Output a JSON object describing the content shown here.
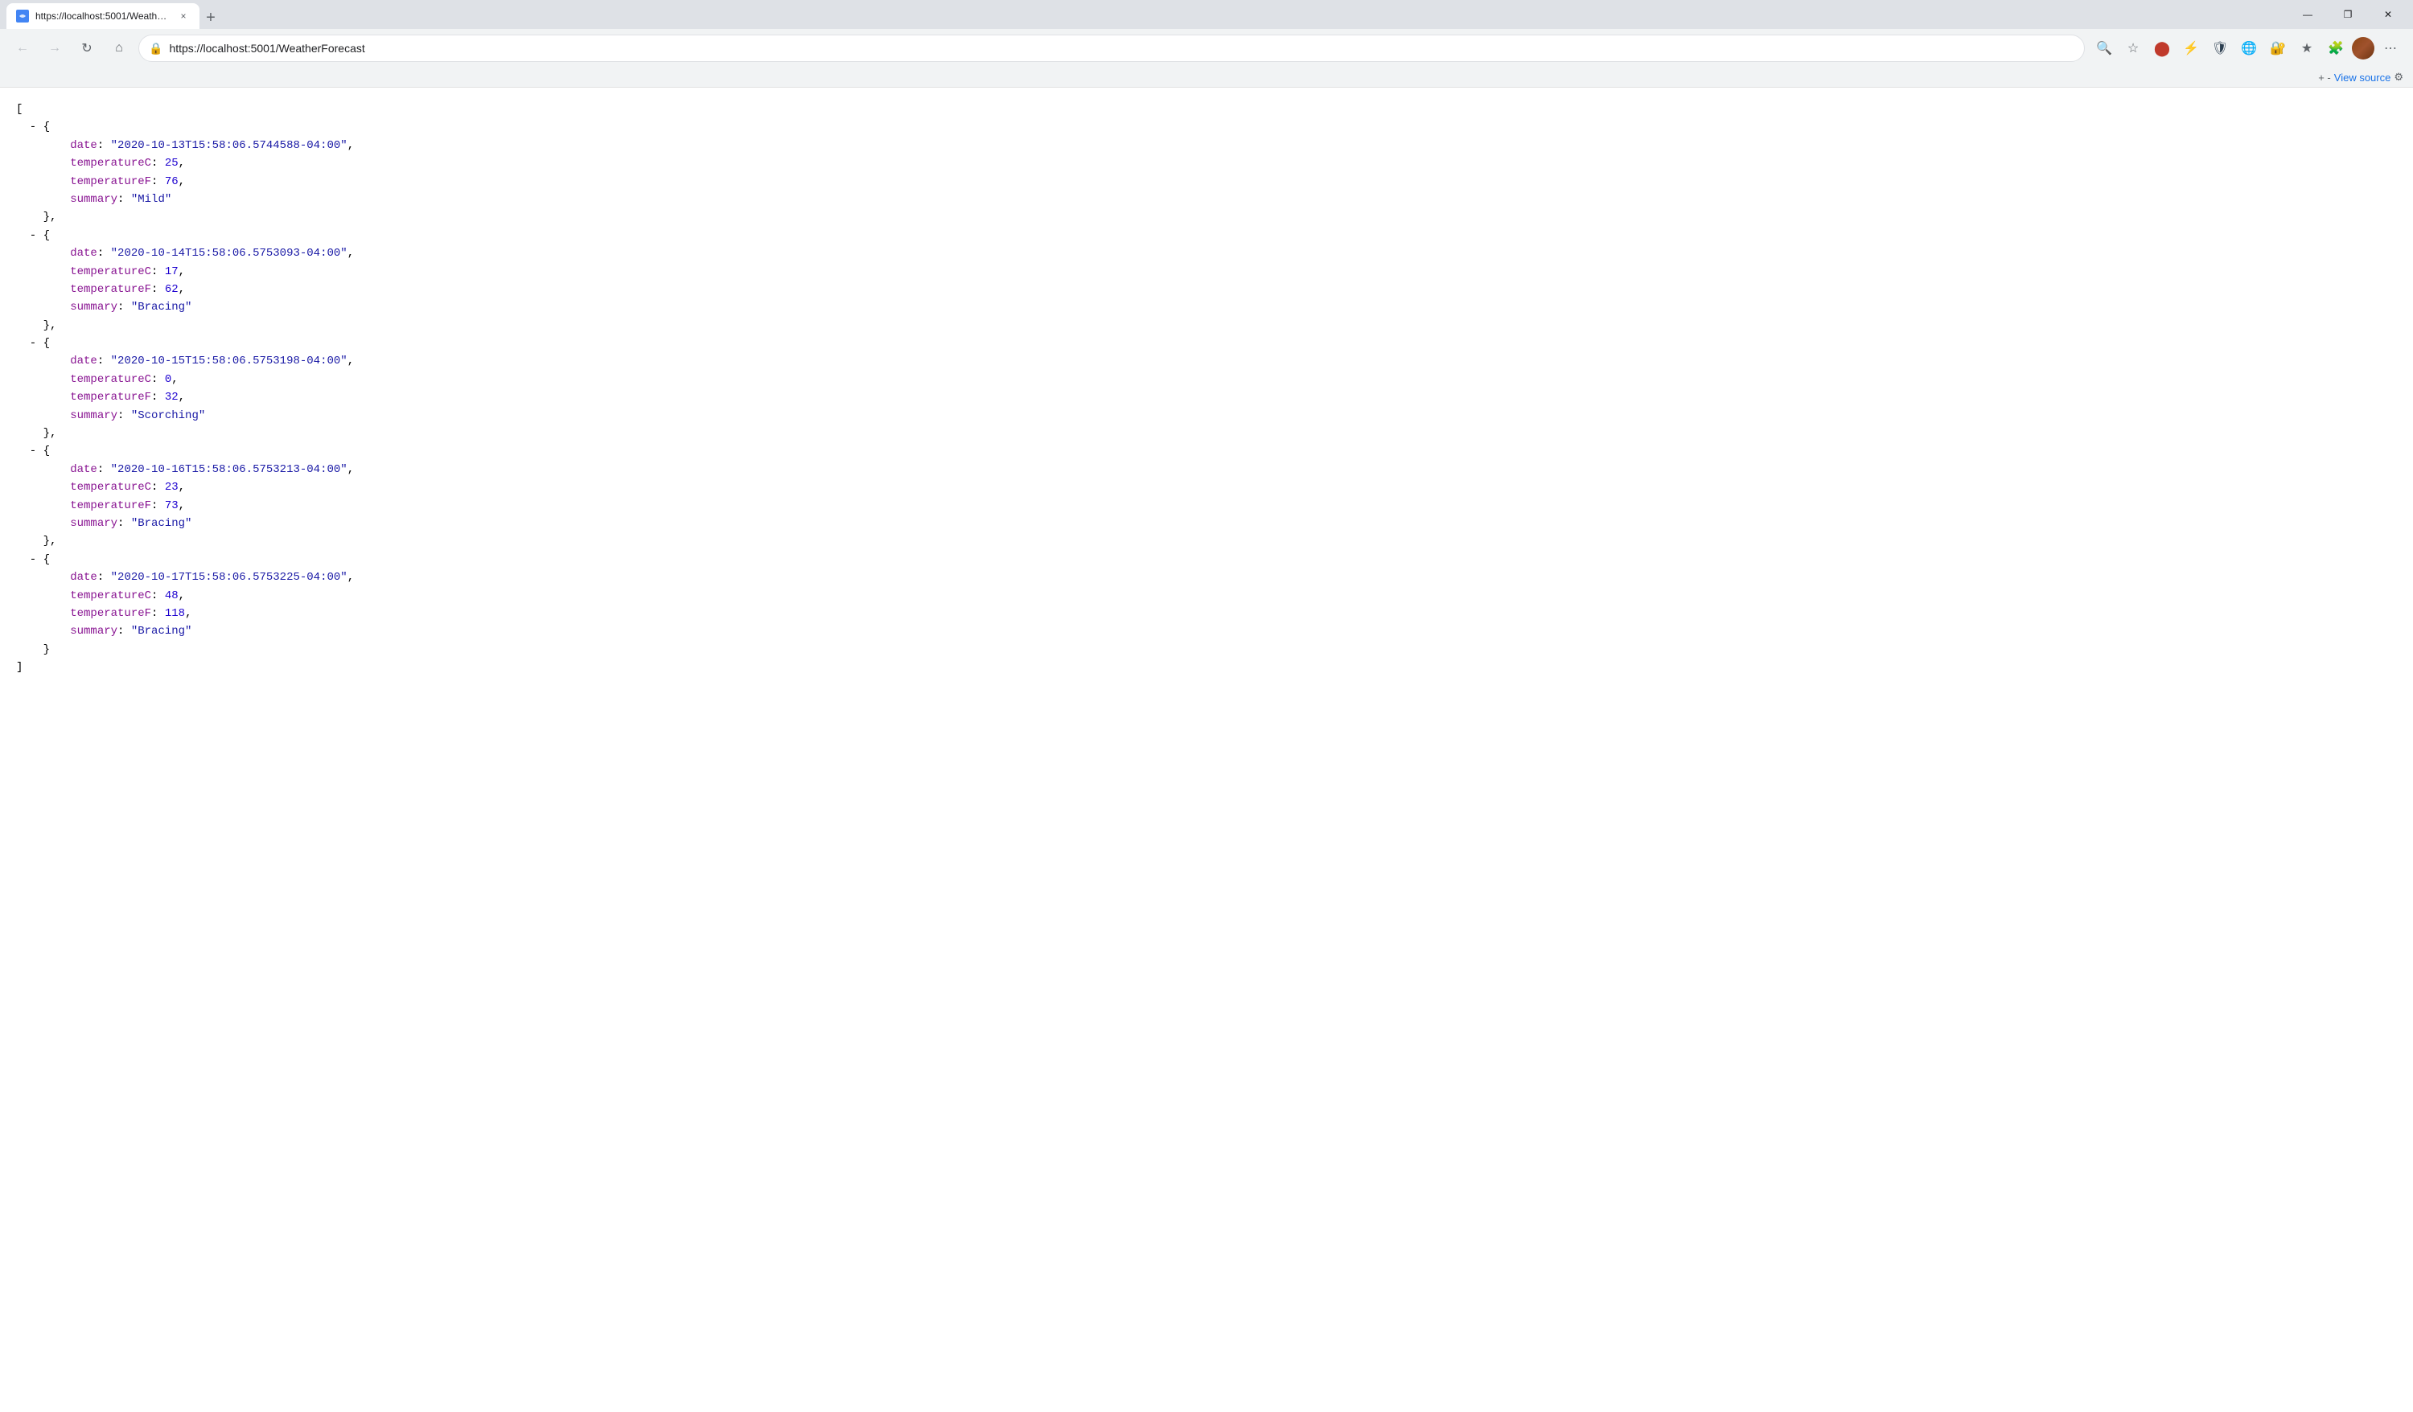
{
  "browser": {
    "tab": {
      "favicon_color": "#4285f4",
      "title": "https://localhost:5001/WeatherF...",
      "close_label": "×"
    },
    "new_tab_label": "+",
    "window_controls": {
      "minimize": "—",
      "maximize": "❐",
      "close": "✕"
    },
    "nav": {
      "back_label": "←",
      "forward_label": "→",
      "reload_label": "↻",
      "home_label": "⌂",
      "address": "https://localhost:5001/WeatherForecast",
      "search_label": "🔍",
      "favorite_label": "☆",
      "more_label": "⋯"
    },
    "view_source": {
      "prefix": "+ -",
      "link_text": "View source",
      "settings_label": "⚙"
    }
  },
  "json_data": {
    "entries": [
      {
        "date": "2020-10-13T15:58:06.5744588-04:00",
        "temperatureC": "25",
        "temperatureF": "76",
        "summary": "Mild"
      },
      {
        "date": "2020-10-14T15:58:06.5753093-04:00",
        "temperatureC": "17",
        "temperatureF": "62",
        "summary": "Bracing"
      },
      {
        "date": "2020-10-15T15:58:06.5753198-04:00",
        "temperatureC": "0",
        "temperatureF": "32",
        "summary": "Scorching"
      },
      {
        "date": "2020-10-16T15:58:06.5753213-04:00",
        "temperatureC": "23",
        "temperatureF": "73",
        "summary": "Bracing"
      },
      {
        "date": "2020-10-17T15:58:06.5753225-04:00",
        "temperatureC": "48",
        "temperatureF": "118",
        "summary": "Bracing"
      }
    ]
  }
}
